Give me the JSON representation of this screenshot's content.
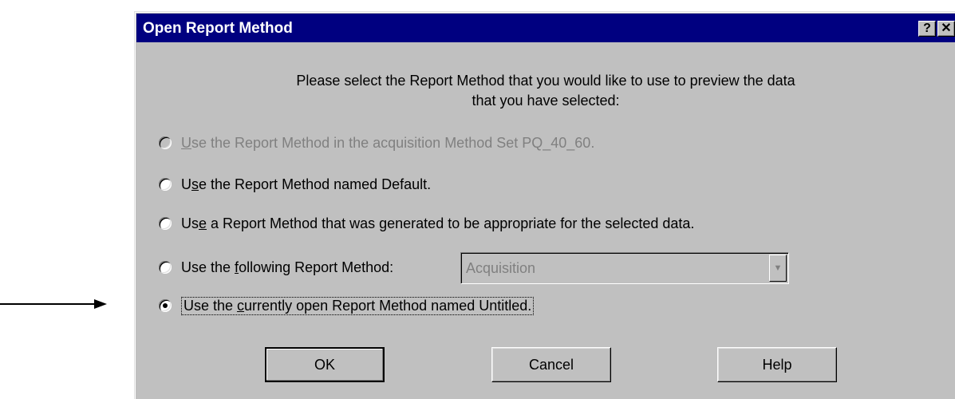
{
  "dialog": {
    "title": "Open Report Method",
    "help_glyph": "?",
    "close_glyph": "✕",
    "prompt_line1": "Please select the Report Method that you would like to use to preview the data",
    "prompt_line2": "that you have selected:"
  },
  "options": [
    {
      "pre": "",
      "key": "U",
      "post": "se the Report Method in the acquisition Method Set PQ_40_60.",
      "enabled": false,
      "selected": false
    },
    {
      "pre": "U",
      "key": "s",
      "post": "e the Report Method named Default.",
      "enabled": true,
      "selected": false
    },
    {
      "pre": "Us",
      "key": "e",
      "post": " a Report Method that was generated to be appropriate for the selected data.",
      "enabled": true,
      "selected": false
    },
    {
      "pre": "Use the ",
      "key": "f",
      "post": "ollowing Report Method:",
      "enabled": true,
      "selected": false
    },
    {
      "pre": "Use the ",
      "key": "c",
      "post": "urrently open Report Method named Untitled.",
      "enabled": true,
      "selected": true
    }
  ],
  "report_method_select": {
    "value": "Acquisition",
    "enabled": false
  },
  "buttons": {
    "ok": "OK",
    "cancel": "Cancel",
    "help": "Help"
  },
  "colors": {
    "titlebar": "#000080",
    "face": "#c0c0c0",
    "disabled_text": "#808080"
  }
}
